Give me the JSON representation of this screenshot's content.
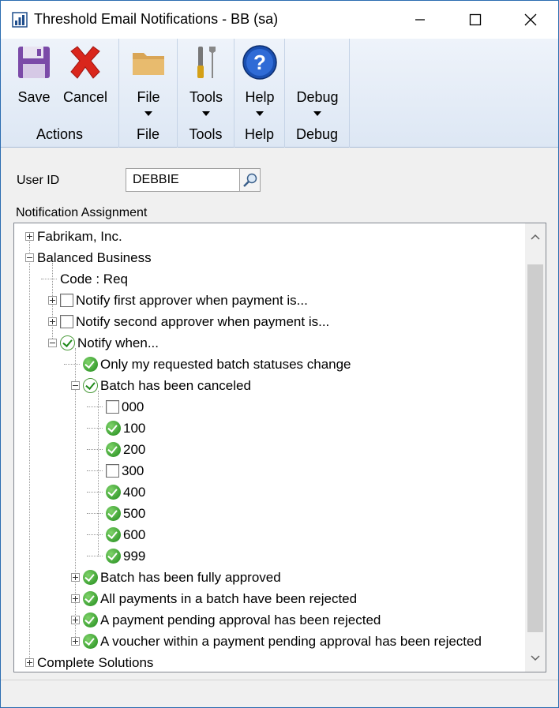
{
  "window": {
    "title": "Threshold Email Notifications  -  BB (sa)",
    "controls": [
      "minimize",
      "maximize",
      "close"
    ]
  },
  "ribbon": {
    "groups": [
      {
        "name": "Actions",
        "buttons": [
          {
            "label": "Save",
            "icon": "save-icon"
          },
          {
            "label": "Cancel",
            "icon": "cancel-icon"
          }
        ]
      },
      {
        "name": "File",
        "buttons": [
          {
            "label": "File",
            "icon": "folder-icon",
            "dropdown": true
          }
        ]
      },
      {
        "name": "Tools",
        "buttons": [
          {
            "label": "Tools",
            "icon": "tools-icon",
            "dropdown": true
          }
        ]
      },
      {
        "name": "Help",
        "buttons": [
          {
            "label": "Help",
            "icon": "help-icon",
            "dropdown": true
          }
        ]
      },
      {
        "name": "Debug",
        "buttons": [
          {
            "label": "Debug",
            "icon": "none",
            "dropdown": true
          }
        ]
      }
    ]
  },
  "form": {
    "user_id_label": "User ID",
    "user_id_value": "DEBBIE",
    "assignment_label": "Notification Assignment"
  },
  "tree": [
    {
      "text": "Fabrikam, Inc.",
      "state": "none",
      "expander": "plus"
    },
    {
      "text": "Balanced Business",
      "state": "none",
      "expander": "minus"
    },
    {
      "text": "Code : Req",
      "state": "none",
      "expander": "none"
    },
    {
      "text": "Notify first approver when payment is...",
      "state": "unchecked",
      "expander": "plus"
    },
    {
      "text": "Notify second approver when payment is...",
      "state": "unchecked",
      "expander": "plus"
    },
    {
      "text": "Notify when...",
      "state": "partial",
      "expander": "minus"
    },
    {
      "text": "Only my requested batch statuses change",
      "state": "checked",
      "expander": "none"
    },
    {
      "text": "Batch has been canceled",
      "state": "partial",
      "expander": "minus"
    },
    {
      "text": "000",
      "state": "unchecked",
      "expander": "none"
    },
    {
      "text": "100",
      "state": "checked",
      "expander": "none"
    },
    {
      "text": "200",
      "state": "checked",
      "expander": "none"
    },
    {
      "text": "300",
      "state": "unchecked",
      "expander": "none"
    },
    {
      "text": "400",
      "state": "checked",
      "expander": "none"
    },
    {
      "text": "500",
      "state": "checked",
      "expander": "none"
    },
    {
      "text": "600",
      "state": "checked",
      "expander": "none"
    },
    {
      "text": "999",
      "state": "checked",
      "expander": "none"
    },
    {
      "text": "Batch has been fully approved",
      "state": "checked",
      "expander": "plus"
    },
    {
      "text": "All payments in a batch have been rejected",
      "state": "checked",
      "expander": "plus"
    },
    {
      "text": "A payment pending approval has been rejected",
      "state": "checked",
      "expander": "plus"
    },
    {
      "text": "A voucher within a payment pending approval has been rejected",
      "state": "checked",
      "expander": "plus"
    },
    {
      "text": "Complete Solutions",
      "state": "none",
      "expander": "plus"
    }
  ]
}
